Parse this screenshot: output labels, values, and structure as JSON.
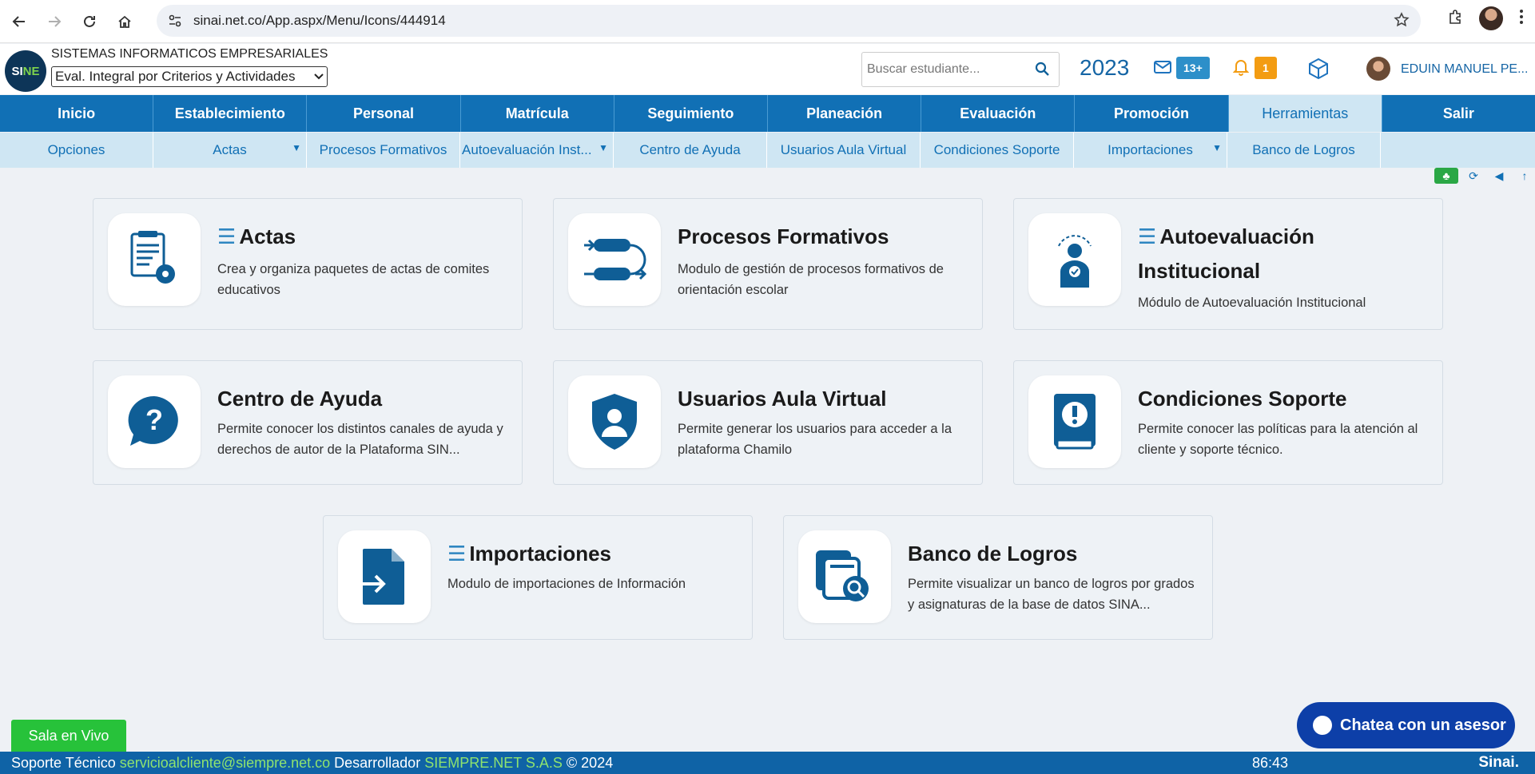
{
  "browser": {
    "url": "sinai.net.co/App.aspx/Menu/Icons/444914"
  },
  "header": {
    "logo_text_a": "SI",
    "logo_text_b": "NE",
    "company": "SISTEMAS INFORMATICOS EMPRESARIALES",
    "evaluation_select": "Eval. Integral por Criterios y Actividades",
    "search_placeholder": "Buscar estudiante...",
    "year": "2023",
    "mail_badge": "13+",
    "notif_badge": "1",
    "user_name": "EDUIN MANUEL PE..."
  },
  "main_menu": [
    {
      "label": "Inicio"
    },
    {
      "label": "Establecimiento"
    },
    {
      "label": "Personal"
    },
    {
      "label": "Matrícula"
    },
    {
      "label": "Seguimiento"
    },
    {
      "label": "Planeación"
    },
    {
      "label": "Evaluación"
    },
    {
      "label": "Promoción"
    },
    {
      "label": "Herramientas"
    },
    {
      "label": "Salir"
    }
  ],
  "sub_menu": [
    {
      "label": "Opciones"
    },
    {
      "label": "Actas"
    },
    {
      "label": "Procesos Formativos"
    },
    {
      "label": "Autoevaluación Inst..."
    },
    {
      "label": "Centro de Ayuda"
    },
    {
      "label": "Usuarios Aula Virtual"
    },
    {
      "label": "Condiciones Soporte"
    },
    {
      "label": "Importaciones"
    },
    {
      "label": "Banco de Logros"
    }
  ],
  "cards": [
    {
      "title": "Actas",
      "desc": "Crea y organiza paquetes de actas de comites educativos"
    },
    {
      "title": "Procesos Formativos",
      "desc": "Modulo de gestión de procesos formativos de orientación escolar"
    },
    {
      "title": "Autoevaluación Institucional",
      "desc": "Módulo de Autoevaluación Institucional"
    },
    {
      "title": "Centro de Ayuda",
      "desc": "Permite conocer los distintos canales de ayuda y derechos de autor de la Plataforma SIN..."
    },
    {
      "title": "Usuarios Aula Virtual",
      "desc": "Permite generar los usuarios para acceder a la plataforma Chamilo"
    },
    {
      "title": "Condiciones Soporte",
      "desc": "Permite conocer las políticas para la atención al cliente y soporte técnico."
    },
    {
      "title": "Importaciones",
      "desc": "Modulo de importaciones de Información"
    },
    {
      "title": "Banco de Logros",
      "desc": "Permite visualizar un banco de logros por grados y asignaturas de la base de datos SINA..."
    }
  ],
  "footer": {
    "sala": "Sala en Vivo",
    "chat": "Chatea con un asesor",
    "support_label": "Soporte Técnico",
    "support_email": "servicioalcliente@siempre.net.co",
    "dev_label": "Desarrollador",
    "dev_name": "SIEMPRE.NET S.A.S",
    "copyright": "© 2024",
    "timer": "86:43",
    "brand": "Sinai."
  },
  "colors": {
    "primary": "#1170b5",
    "submenu": "#cfe6f3",
    "footer": "#0f63a6",
    "accent_green": "#27c23a",
    "chat": "#0d3fa8"
  }
}
